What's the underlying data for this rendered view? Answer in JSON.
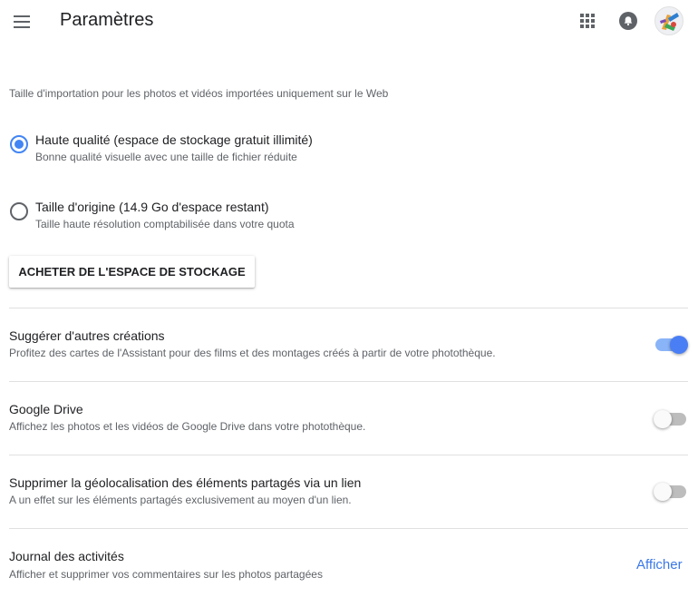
{
  "header": {
    "title": "Paramètres",
    "menu_icon": "hamburger-menu-icon",
    "apps_icon": "apps-grid-icon",
    "notifications_icon": "bell-icon",
    "avatar": "user-avatar"
  },
  "upload": {
    "section_label": "Taille d'importation pour les photos et vidéos importées uniquement sur le Web",
    "options": [
      {
        "title": "Haute qualité (espace de stockage gratuit illimité)",
        "subtitle": "Bonne qualité visuelle avec une taille de fichier réduite",
        "selected": true
      },
      {
        "title": "Taille d'origine (14.9 Go d'espace restant)",
        "subtitle": "Taille haute résolution comptabilisée dans votre quota",
        "selected": false
      }
    ],
    "buy_button": "ACHETER DE L'ESPACE DE STOCKAGE"
  },
  "settings": [
    {
      "title": "Suggérer d'autres créations",
      "description": "Profitez des cartes de l'Assistant pour des films et des montages créés à partir de votre photothèque.",
      "enabled": true
    },
    {
      "title": "Google Drive",
      "description": "Affichez les photos et les vidéos de Google Drive dans votre photothèque.",
      "enabled": false
    },
    {
      "title": "Supprimer la géolocalisation des éléments partagés via un lien",
      "description": "A un effet sur les éléments partagés exclusivement au moyen d'un lien.",
      "enabled": false
    }
  ],
  "activity": {
    "title": "Journal des activités",
    "description": "Afficher et supprimer vos commentaires sur les photos partagées",
    "link": "Afficher"
  },
  "colors": {
    "accent": "#4285f4",
    "toggle_on_thumb": "#4a7ef5",
    "toggle_on_track": "#8ab4f8",
    "link": "#3b78e7",
    "divider": "#e0e0e0"
  }
}
